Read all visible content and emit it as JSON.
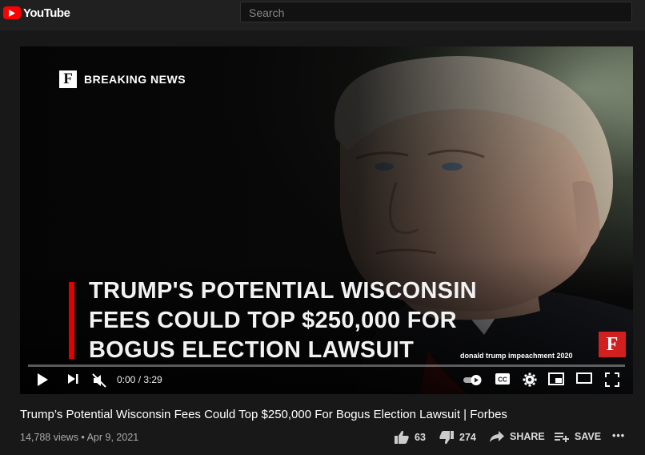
{
  "header": {
    "logo_text": "YouTube",
    "search_placeholder": "Search"
  },
  "video": {
    "brand_label": "BREAKING NEWS",
    "brand_letter": "F",
    "headline": "TRUMP'S POTENTIAL WISCONSIN FEES COULD TOP $250,000 FOR BOGUS ELECTION LAWSUIT",
    "watermark_text": "donald trump impeachment 2020",
    "corner_logo_letter": "F",
    "progress": 0,
    "time_display": "0:00 / 3:29"
  },
  "info": {
    "title": "Trump’s Potential Wisconsin Fees Could Top $250,000 For Bogus Election Lawsuit | Forbes",
    "meta": "14,788 views • Apr 9, 2021",
    "like_count": "63",
    "dislike_count": "274",
    "share_label": "SHARE",
    "save_label": "SAVE",
    "more_label": "•••"
  },
  "colors": {
    "youtube_red": "#ff0000",
    "forbes_red": "#d21f1f",
    "headline_bar_red": "#e00000",
    "page_background": "#181818",
    "header_background": "#202020"
  },
  "icons": [
    "youtube-play-icon",
    "play-icon",
    "next-icon",
    "mute-icon",
    "autoplay-toggle-icon",
    "captions-icon",
    "settings-gear-icon",
    "miniplayer-icon",
    "theater-mode-icon",
    "fullscreen-icon",
    "thumbs-up-icon",
    "thumbs-down-icon",
    "share-arrow-icon",
    "save-playlist-icon"
  ]
}
